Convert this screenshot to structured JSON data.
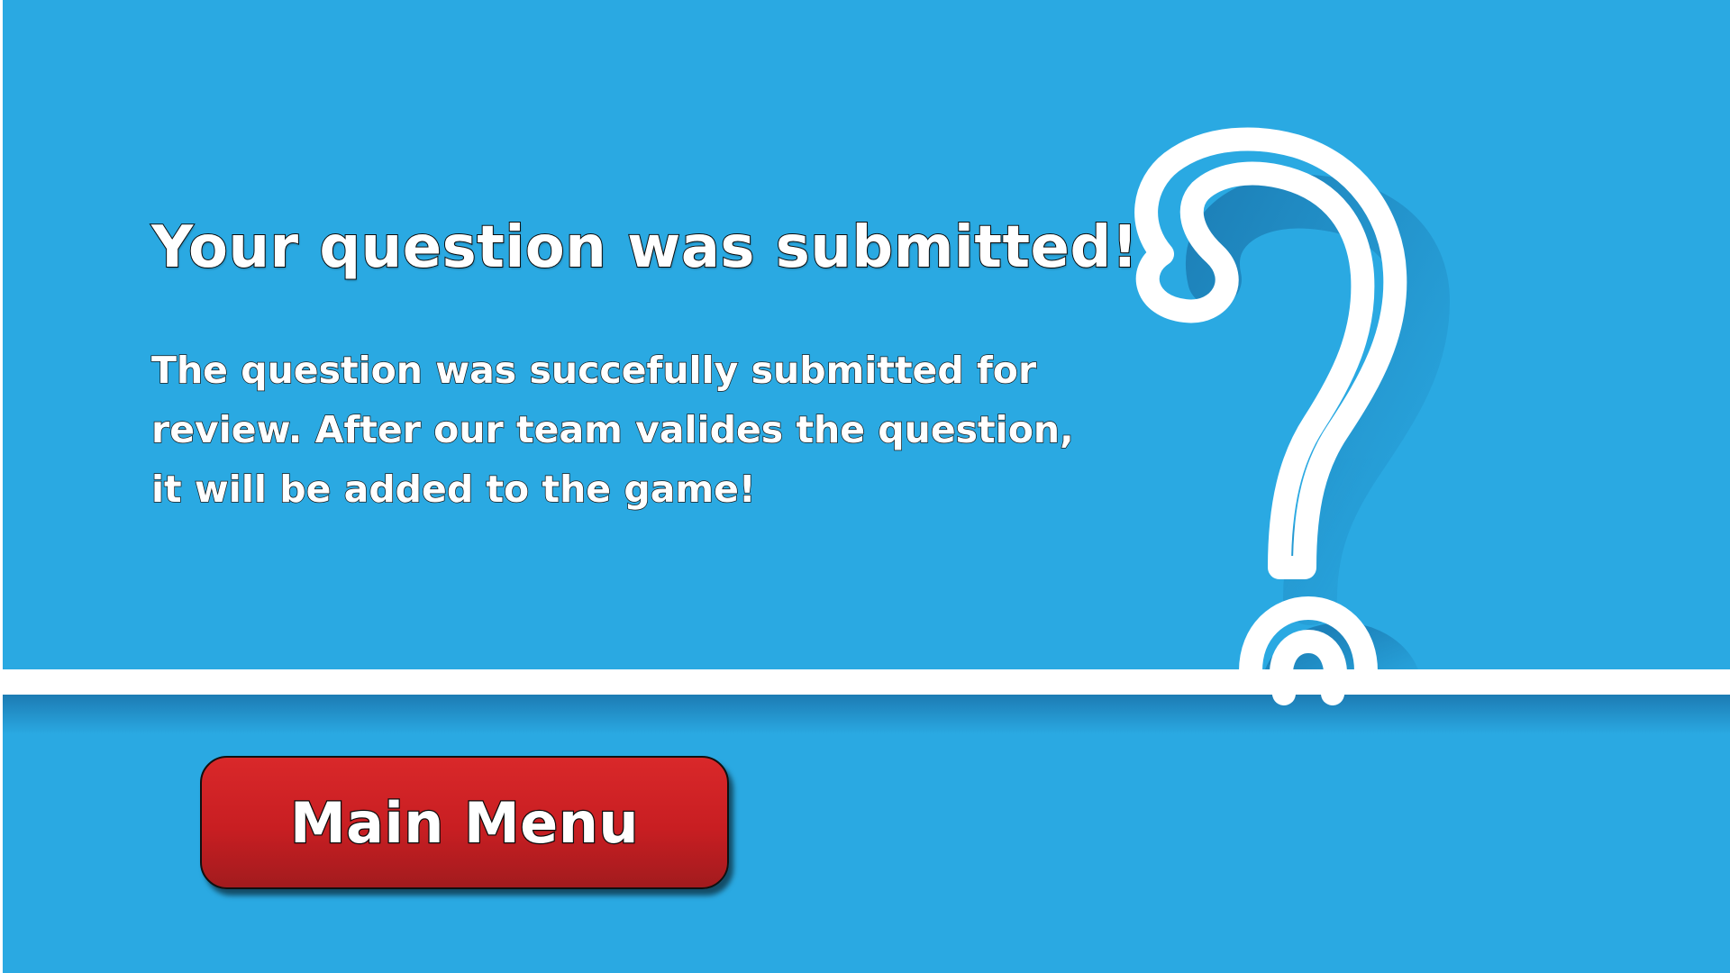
{
  "screen": {
    "title": "Your question was submitted!",
    "message": "The question was succefully submitted for review. After our team valides the question, it will be added to the game!"
  },
  "main_menu_button": {
    "label": "Main Menu"
  },
  "colors": {
    "background": "#2aa9e2",
    "line": "#ffffff",
    "button": "#c81e22"
  },
  "decoration": {
    "icon": "question-mark-icon"
  }
}
